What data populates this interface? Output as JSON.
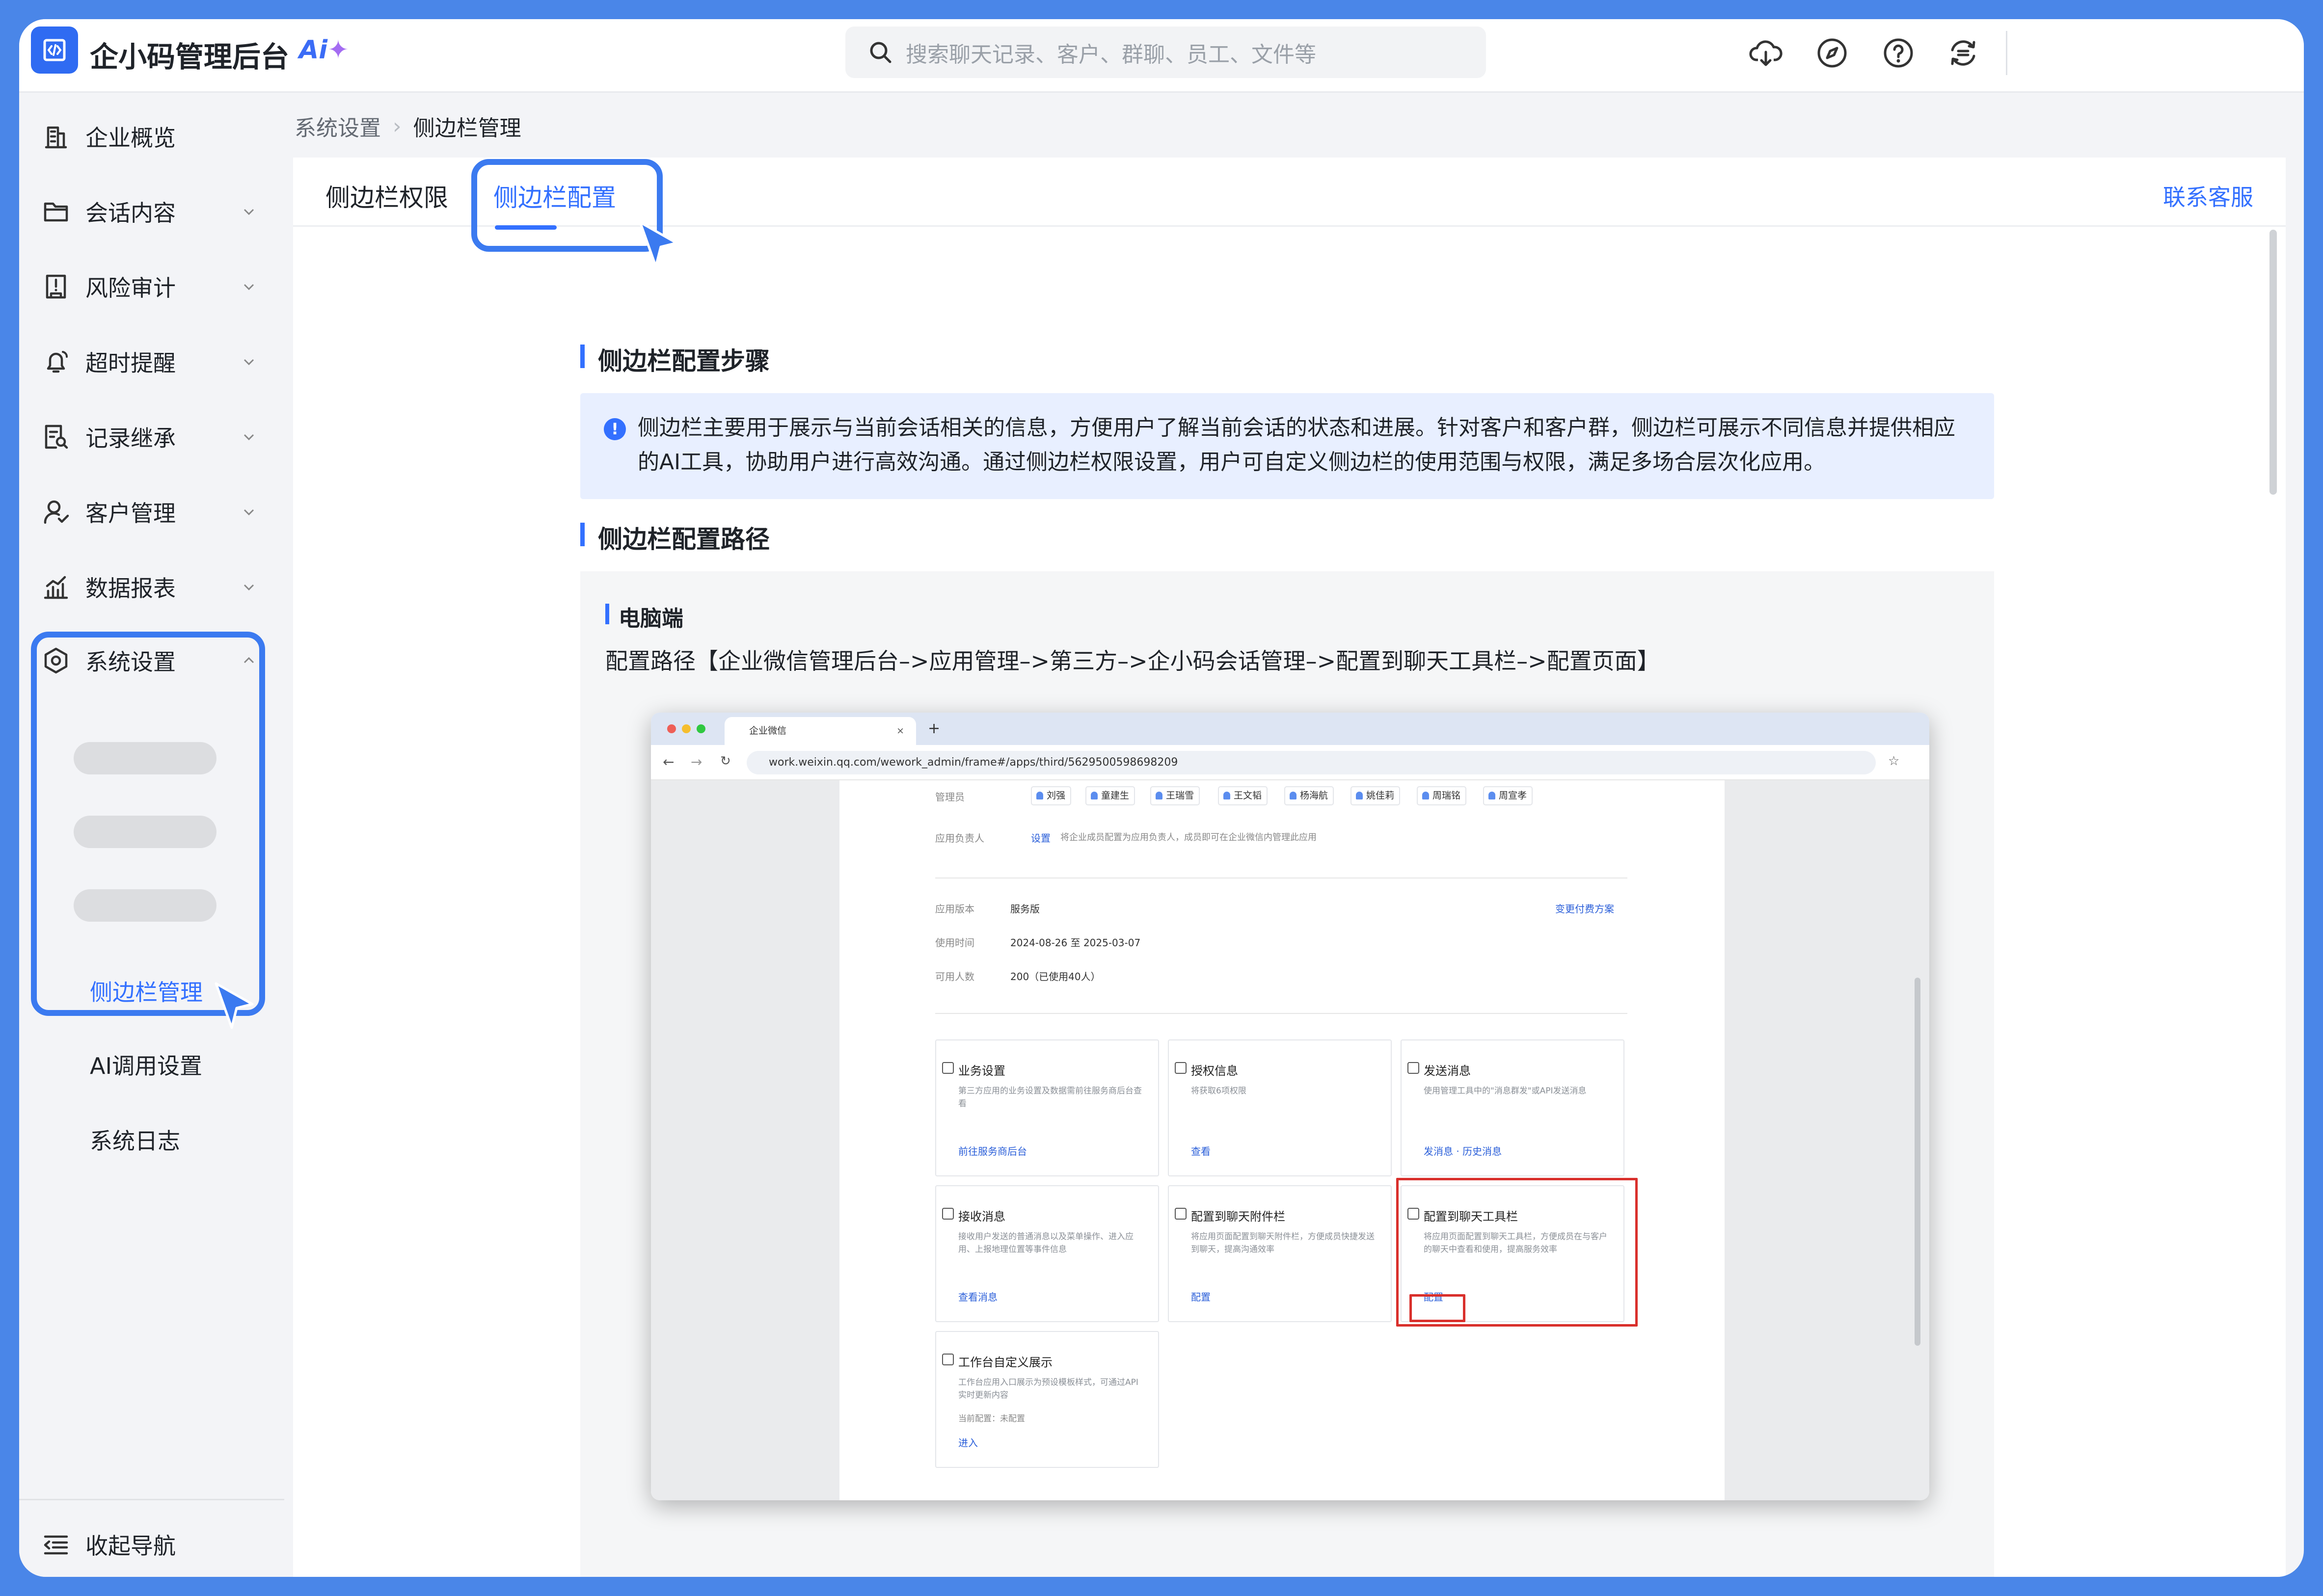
{
  "app": {
    "title": "企小码管理后台",
    "ai_badge": "Ai"
  },
  "search": {
    "placeholder": "搜索聊天记录、客户、群聊、员工、文件等"
  },
  "topbar_icons": [
    "cloud-download-icon",
    "compass-icon",
    "help-icon",
    "sync-icon"
  ],
  "sidebar": {
    "items": [
      {
        "label": "企业概览",
        "icon": "building-icon"
      },
      {
        "label": "会话内容",
        "icon": "folder-icon"
      },
      {
        "label": "风险审计",
        "icon": "audit-icon"
      },
      {
        "label": "超时提醒",
        "icon": "bell-icon"
      },
      {
        "label": "记录继承",
        "icon": "record-icon"
      },
      {
        "label": "客户管理",
        "icon": "customer-icon"
      },
      {
        "label": "数据报表",
        "icon": "chart-icon"
      },
      {
        "label": "系统设置",
        "icon": "settings-icon"
      }
    ],
    "sub_items": [
      {
        "label": "侧边栏管理",
        "active": true
      },
      {
        "label": "AI调用设置",
        "active": false
      },
      {
        "label": "系统日志",
        "active": false
      }
    ],
    "collapse_label": "收起导航"
  },
  "breadcrumb": [
    "系统设置",
    "侧边栏管理"
  ],
  "tabs": [
    {
      "label": "侧边栏权限",
      "active": false
    },
    {
      "label": "侧边栏配置",
      "active": true
    }
  ],
  "contact_link": "联系客服",
  "section1": {
    "title": "侧边栏配置步骤"
  },
  "info_text": "侧边栏主要用于展示与当前会话相关的信息，方便用户了解当前会话的状态和进展。针对客户和客户群，侧边栏可展示不同信息并提供相应的AI工具，协助用户进行高效沟通。通过侧边栏权限设置，用户可自定义侧边栏的使用范围与权限，满足多场合层次化应用。",
  "section2": {
    "title": "侧边栏配置路径"
  },
  "pc": {
    "title": "电脑端",
    "path": "配置路径【企业微信管理后台–>应用管理–>第三方–>企小码会话管理–>配置到聊天工具栏–>配置页面】"
  },
  "screenshot": {
    "tab_title": "企业微信",
    "url": "work.weixin.qq.com/wework_admin/frame#/apps/third/5629500598698209",
    "admin_label": "管理员",
    "admins": [
      "刘强",
      "童建生",
      "王瑞雪",
      "王文韬",
      "杨海航",
      "姚佳莉",
      "周瑞铭",
      "周宣孝"
    ],
    "owner_label": "应用负责人",
    "owner_link": "设置",
    "owner_note": "将企业成员配置为应用负责人，成员即可在企业微信内管理此应用",
    "version_label": "应用版本",
    "version_value": "服务版",
    "change_plan": "变更付费方案",
    "time_label": "使用时间",
    "time_value": "2024-08-26 至 2025-03-07",
    "users_label": "可用人数",
    "users_value": "200（已使用40人）",
    "cards": [
      {
        "title": "业务设置",
        "desc": "第三方应用的业务设置及数据需前往服务商后台查看",
        "action": "前往服务商后台"
      },
      {
        "title": "授权信息",
        "desc": "将获取6项权限",
        "action": "查看"
      },
      {
        "title": "发送消息",
        "desc": "使用管理工具中的\"消息群发\"或API发送消息",
        "action": "发消息 · 历史消息"
      },
      {
        "title": "接收消息",
        "desc": "接收用户发送的普通消息以及菜单操作、进入应用、上报地理位置等事件信息",
        "action": "查看消息"
      },
      {
        "title": "配置到聊天附件栏",
        "desc": "将应用页面配置到聊天附件栏，方便成员快捷发送到聊天，提高沟通效率",
        "action": "配置"
      },
      {
        "title": "配置到聊天工具栏",
        "desc": "将应用页面配置到聊天工具栏，方便成员在与客户的聊天中查看和使用，提高服务效率",
        "action": "配置"
      },
      {
        "title": "工作台自定义展示",
        "desc": "工作台应用入口展示为预设模板样式，可通过API实时更新内容",
        "action": "进入",
        "extra": "当前配置：未配置"
      }
    ]
  },
  "colors": {
    "accent": "#3370ff",
    "frame": "#4a86e8",
    "highlight": "#d9302c"
  }
}
